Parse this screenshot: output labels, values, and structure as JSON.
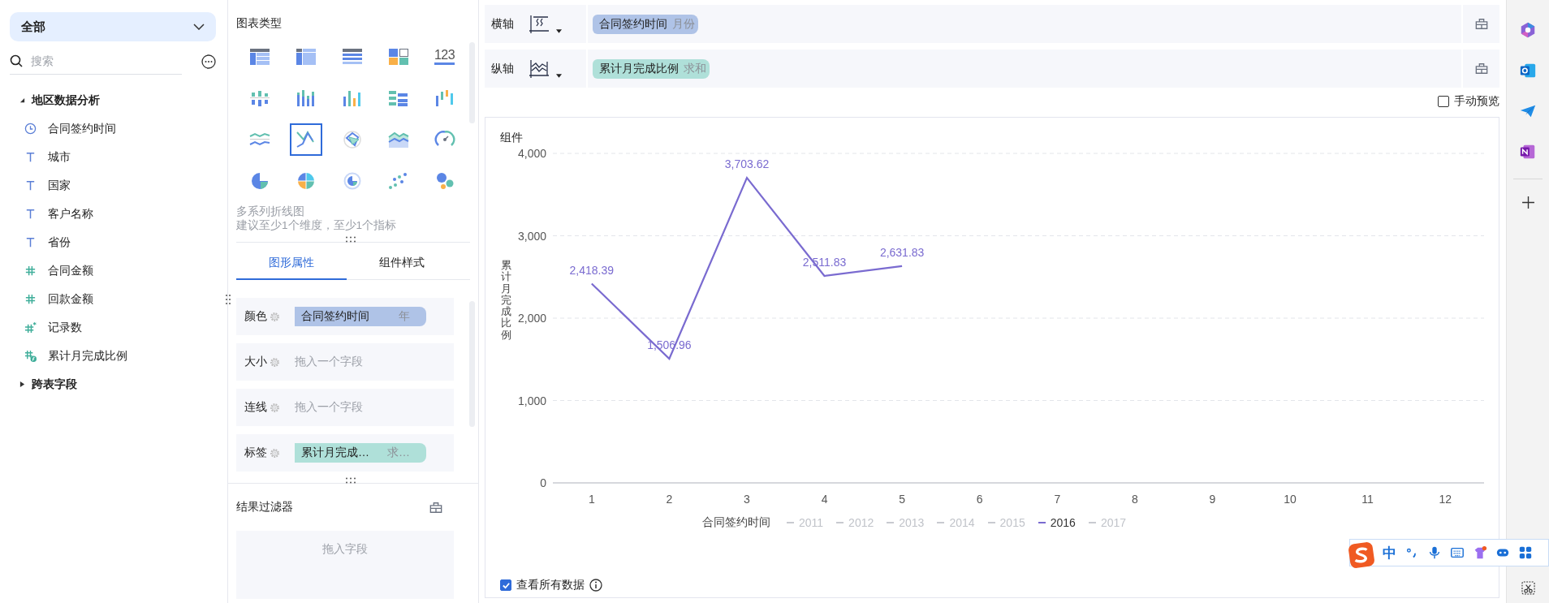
{
  "field_panel": {
    "scope_dropdown": {
      "value": "全部"
    },
    "search": {
      "placeholder": "搜索"
    },
    "tree": [
      {
        "label": "地区数据分析",
        "expanded": true,
        "children": [
          {
            "label": "合同签约时间",
            "kind": "date"
          },
          {
            "label": "城市",
            "kind": "text"
          },
          {
            "label": "国家",
            "kind": "text"
          },
          {
            "label": "客户名称",
            "kind": "text"
          },
          {
            "label": "省份",
            "kind": "text"
          },
          {
            "label": "合同金额",
            "kind": "number"
          },
          {
            "label": "回款金额",
            "kind": "number"
          },
          {
            "label": "记录数",
            "kind": "count"
          },
          {
            "label": "累计月完成比例",
            "kind": "calc"
          }
        ]
      },
      {
        "label": "跨表字段",
        "expanded": false
      }
    ]
  },
  "chart_type_panel": {
    "title": "图表类型",
    "types": [
      {
        "kind": "table",
        "selected": false
      },
      {
        "kind": "cross-table",
        "selected": false
      },
      {
        "kind": "detail-table",
        "selected": false
      },
      {
        "kind": "card",
        "selected": false
      },
      {
        "kind": "number",
        "label": "123",
        "selected": false
      },
      {
        "kind": "grouped-bar",
        "selected": false
      },
      {
        "kind": "stacked-bar",
        "selected": false
      },
      {
        "kind": "bar",
        "selected": false
      },
      {
        "kind": "horizontal-bar",
        "selected": false
      },
      {
        "kind": "range-bar",
        "selected": false
      },
      {
        "kind": "split-line",
        "selected": false
      },
      {
        "kind": "multi-line",
        "selected": true
      },
      {
        "kind": "radar",
        "selected": false
      },
      {
        "kind": "area",
        "selected": false
      },
      {
        "kind": "gauge",
        "selected": false
      },
      {
        "kind": "pie",
        "selected": false
      },
      {
        "kind": "multi-pie",
        "selected": false
      },
      {
        "kind": "ring",
        "selected": false
      },
      {
        "kind": "scatter",
        "selected": false
      },
      {
        "kind": "bubble",
        "selected": false
      }
    ],
    "selected_name": "多系列折线图",
    "hint": "建议至少1个维度，至少1个指标"
  },
  "property_tabs": [
    {
      "label": "图形属性",
      "selected": true
    },
    {
      "label": "组件样式",
      "selected": false
    }
  ],
  "properties": [
    {
      "label": "颜色",
      "field": {
        "name": "合同签约时间",
        "aggregation": "年",
        "kind": "dimension"
      }
    },
    {
      "label": "大小",
      "placeholder": "拖入一个字段"
    },
    {
      "label": "连线",
      "placeholder": "拖入一个字段"
    },
    {
      "label": "标签",
      "field": {
        "name": "累计月完成…",
        "aggregation": "求…",
        "kind": "measure"
      }
    }
  ],
  "result_filter": {
    "title": "结果过滤器",
    "placeholder": "拖入字段"
  },
  "axes": [
    {
      "label": "横轴",
      "kind": "x",
      "field": {
        "name": "合同签约时间",
        "aggregation": "月份",
        "kind": "dimension"
      }
    },
    {
      "label": "纵轴",
      "kind": "y",
      "field": {
        "name": "累计月完成比例",
        "aggregation": "求和",
        "kind": "measure"
      }
    }
  ],
  "manual_preview": {
    "label": "手动预览",
    "checked": false
  },
  "component": {
    "title": "组件",
    "chart_data": {
      "type": "line",
      "ylabel": "累计月完成比例",
      "categories": [
        "1",
        "2",
        "3",
        "4",
        "5",
        "6",
        "7",
        "8",
        "9",
        "10",
        "11",
        "12"
      ],
      "series": [
        {
          "name": "2016",
          "color": "#7a6bd0",
          "values": [
            2418.39,
            1506.96,
            3703.62,
            2511.83,
            2631.83,
            null,
            null,
            null,
            null,
            null,
            null,
            null
          ]
        }
      ],
      "ylim": [
        0,
        4000
      ],
      "grid": true,
      "yticks": [
        {
          "value": 0,
          "label": "0"
        },
        {
          "value": 1000,
          "label": "1,000"
        },
        {
          "value": 2000,
          "label": "2,000"
        },
        {
          "value": 3000,
          "label": "3,000"
        },
        {
          "value": 4000,
          "label": "4,000"
        }
      ],
      "value_labels": [
        "2,418.39",
        "1,506.96",
        "3,703.62",
        "2,511.83",
        "2,631.83",
        null,
        null,
        null,
        null,
        null,
        null,
        null
      ]
    },
    "legend": {
      "title": "合同签约时间",
      "items": [
        {
          "label": "2011",
          "selected": false
        },
        {
          "label": "2012",
          "selected": false
        },
        {
          "label": "2013",
          "selected": false
        },
        {
          "label": "2014",
          "selected": false
        },
        {
          "label": "2015",
          "selected": false
        },
        {
          "kind": "series",
          "selected": true
        },
        {
          "label": "2017",
          "selected": false
        }
      ]
    },
    "show_all_data": {
      "label": "查看所有数据",
      "checked": true
    }
  },
  "ime_toolbar": {
    "mode": "中"
  }
}
